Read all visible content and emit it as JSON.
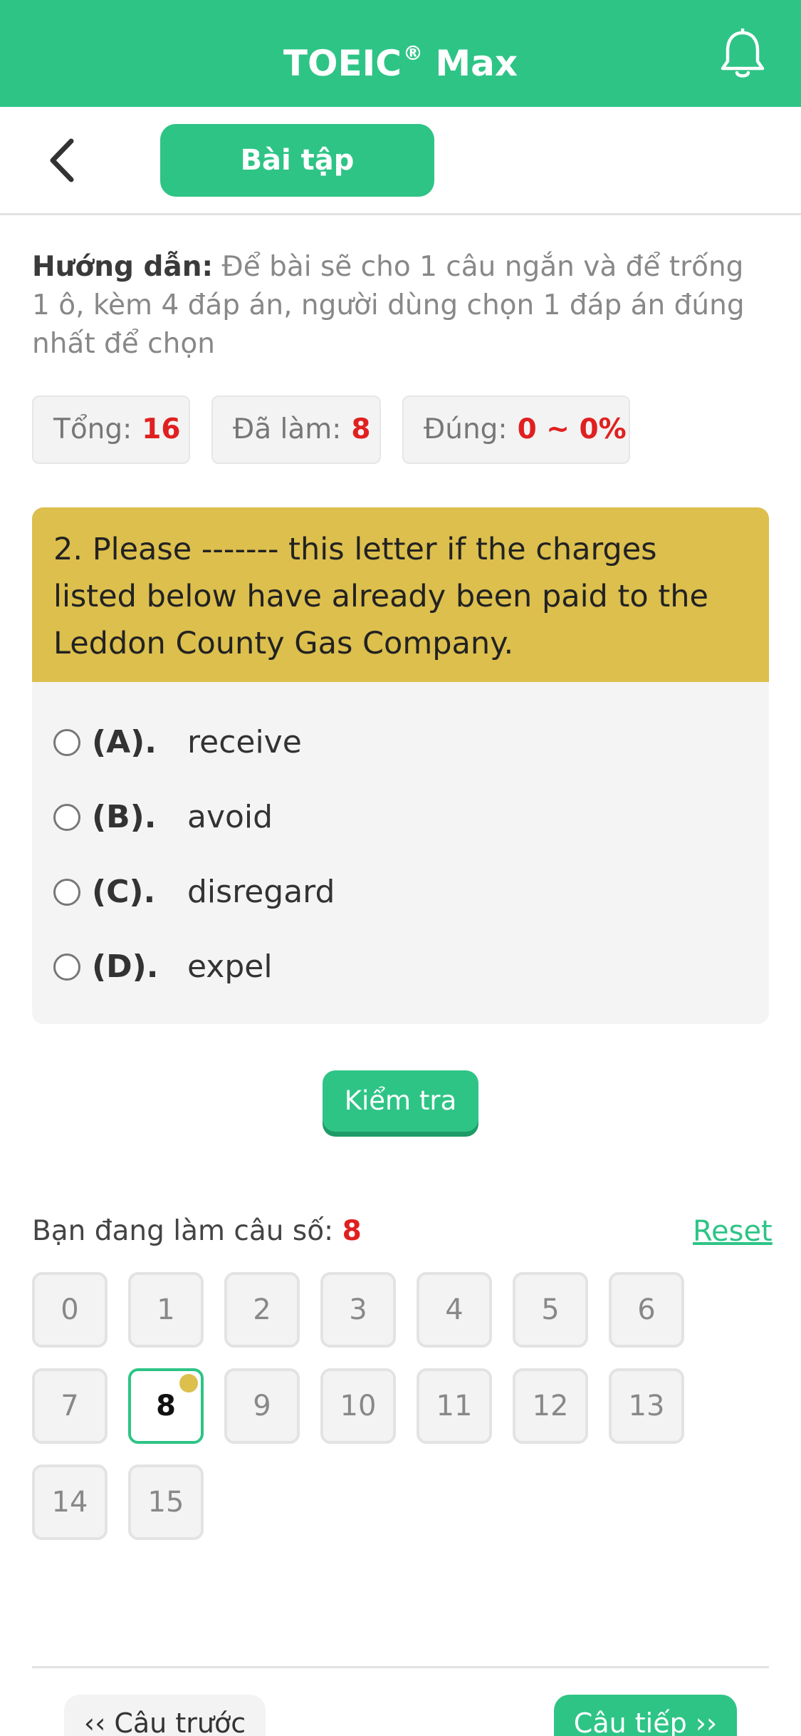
{
  "header": {
    "title": "TOEIC",
    "title_mark": "®",
    "title_suffix": "Max",
    "bell_icon": "bell-icon"
  },
  "subbar": {
    "back_icon": "chevron-left-icon",
    "tab_label": "Bài tập"
  },
  "guide": {
    "label": "Hướng dẫn:",
    "text": "Để bài sẽ cho 1 câu ngắn và để trống 1 ô, kèm 4 đáp án, người dùng chọn 1 đáp án đúng nhất để chọn"
  },
  "stats": [
    {
      "label": "Tổng:",
      "value": "16"
    },
    {
      "label": "Đã làm:",
      "value": "8"
    },
    {
      "label": "Đúng:",
      "value": "0 ~ 0%"
    }
  ],
  "question": {
    "text": "2. Please ------- this letter if the charges listed below have already been paid to the Leddon County Gas Company.",
    "options": [
      {
        "letter": "(A).",
        "text": "receive"
      },
      {
        "letter": "(B).",
        "text": "avoid"
      },
      {
        "letter": "(C).",
        "text": "disregard"
      },
      {
        "letter": "(D).",
        "text": "expel"
      }
    ]
  },
  "check_label": "Kiểm tra",
  "progress": {
    "label": "Bạn đang làm câu số:",
    "current": "8",
    "reset_label": "Reset"
  },
  "grid": {
    "cells": [
      "0",
      "1",
      "2",
      "3",
      "4",
      "5",
      "6",
      "7",
      "8",
      "9",
      "10",
      "11",
      "12",
      "13",
      "14",
      "15"
    ],
    "active_index": 8
  },
  "nav": {
    "prev_label": "‹‹ Câu trước",
    "next_label": "Câu tiếp ››"
  },
  "colors": {
    "primary": "#2ec486",
    "question_bg": "#dcbf4d",
    "highlight": "#e02020"
  }
}
